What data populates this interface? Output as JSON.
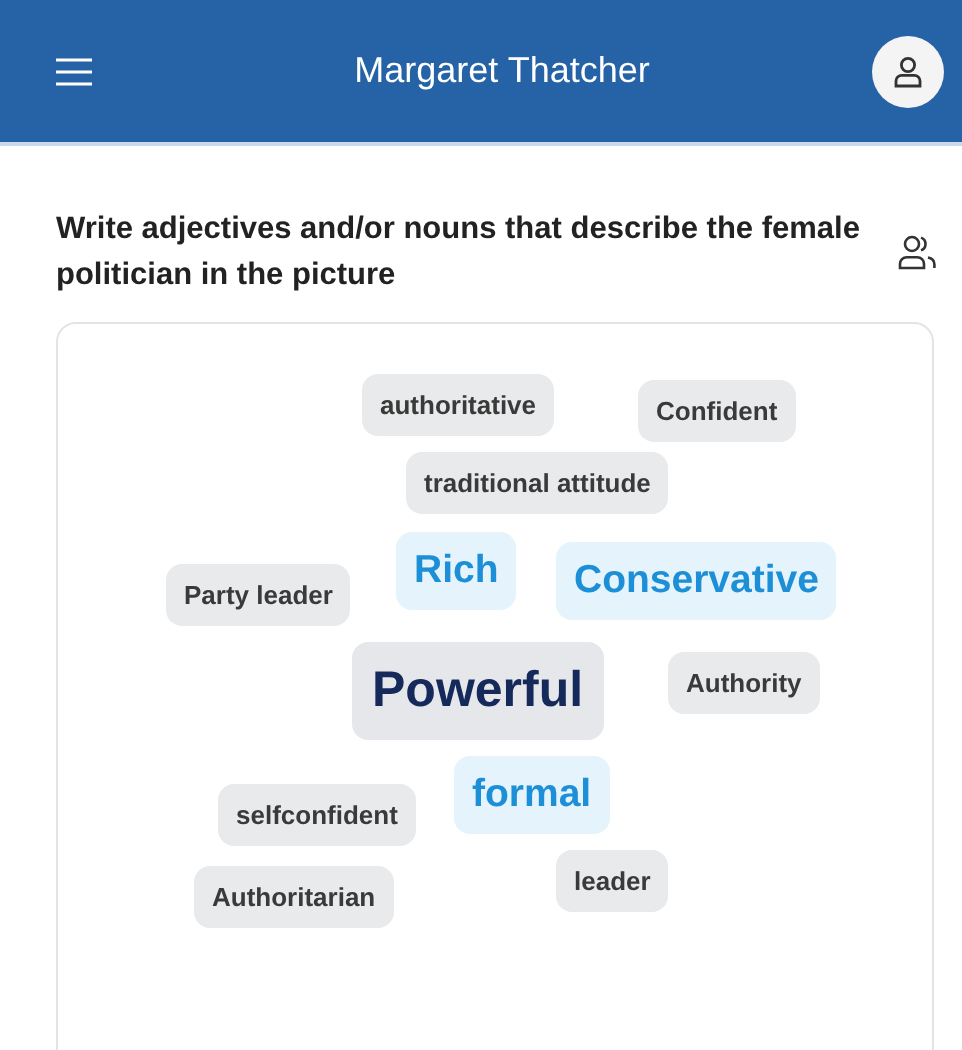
{
  "header": {
    "title": "Margaret Thatcher"
  },
  "question": {
    "text": "Write adjectives and/or nouns that describe the female politician in the picture"
  },
  "word_cloud": [
    {
      "word": "authoritative",
      "kind": "small"
    },
    {
      "word": "Confident",
      "kind": "small"
    },
    {
      "word": "traditional attitude",
      "kind": "small"
    },
    {
      "word": "Rich",
      "kind": "medium"
    },
    {
      "word": "Conservative",
      "kind": "medium"
    },
    {
      "word": "Party leader",
      "kind": "small"
    },
    {
      "word": "Powerful",
      "kind": "large"
    },
    {
      "word": "Authority",
      "kind": "small"
    },
    {
      "word": "formal",
      "kind": "medium"
    },
    {
      "word": "selfconfident",
      "kind": "small"
    },
    {
      "word": "Authoritarian",
      "kind": "small"
    },
    {
      "word": "leader",
      "kind": "small"
    }
  ]
}
